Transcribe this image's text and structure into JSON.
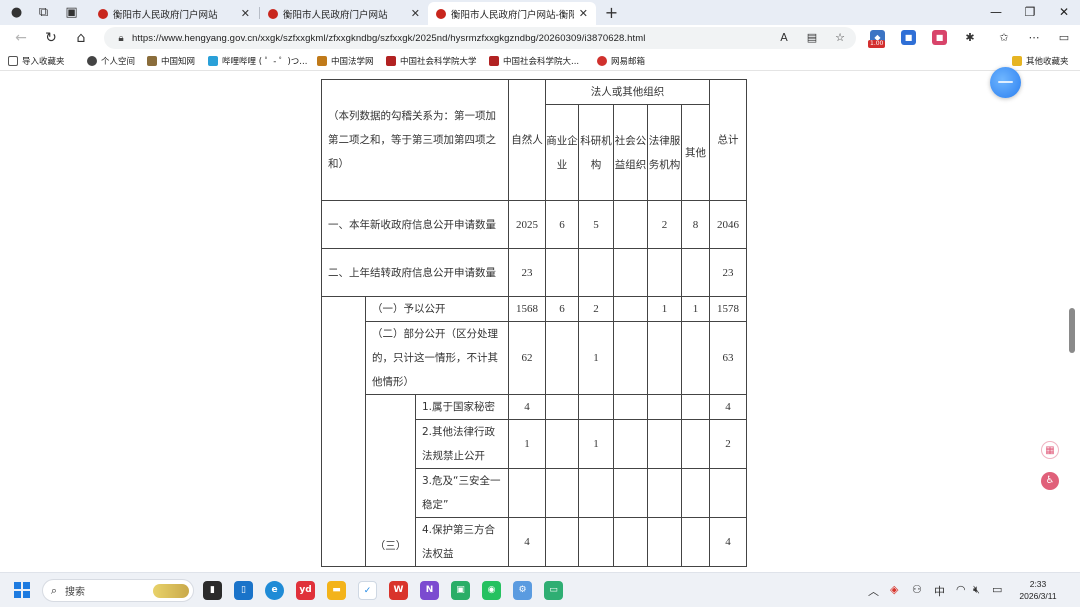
{
  "tabs": [
    {
      "title": "衡阳市人民政府门户网站",
      "active": false
    },
    {
      "title": "衡阳市人民政府门户网站",
      "active": false
    },
    {
      "title": "衡阳市人民政府门户网站-衡阳市...",
      "active": true
    }
  ],
  "tab_controls": {
    "new_tab": "+",
    "close": "✕"
  },
  "window": {
    "minimize": "—",
    "restore": "❐",
    "close": "✕"
  },
  "address": {
    "url": "https://www.hengyang.gov.cn/xxgk/szfxxgkml/zfxxgkndbg/szfxxgk/2025nd/hysrmzfxxgkgzndbg/20260309/i3870628.html"
  },
  "extension_badge": "1.00",
  "bookmarks": [
    {
      "label": "导入收藏夹",
      "color": "#555555"
    },
    {
      "label": "个人空间",
      "color": "#444444"
    },
    {
      "label": "中国知网",
      "color": "#8a6d3b"
    },
    {
      "label": "哔哩哔哩 ( ゜- ゜)つ...",
      "color": "#2aa0d8"
    },
    {
      "label": "中国法学网",
      "color": "#c07a1a"
    },
    {
      "label": "中国社会科学院大学",
      "color": "#b22222"
    },
    {
      "label": "中国社会科学院大...",
      "color": "#b22222"
    },
    {
      "label": "网易邮箱",
      "color": "#d0312d"
    },
    {
      "label": "其他收藏夹",
      "color": "#e6b422"
    }
  ],
  "table": {
    "header_note": "（本列数据的勾稽关系为：第一项加第二项之和，等于第三项加第四项之和）",
    "col_natural": "自然人",
    "col_group": "法人或其他组织",
    "col_business": "商业企业",
    "col_research": "科研机构",
    "col_social": "社会公益组织",
    "col_legal": "法律服务机构",
    "col_other": "其他",
    "col_total": "总计",
    "rows": [
      {
        "label": "一、本年新收政府信息公开申请数量",
        "values": [
          "2025",
          "6",
          "5",
          "",
          "2",
          "8",
          "2046"
        ]
      },
      {
        "label": "二、上年结转政府信息公开申请数量",
        "values": [
          "23",
          "",
          "",
          "",
          "",
          "",
          "23"
        ]
      },
      {
        "label": "（一）予以公开",
        "values": [
          "1568",
          "6",
          "2",
          "",
          "1",
          "1",
          "1578"
        ]
      },
      {
        "label": "（二）部分公开（区分处理的，只计这一情形，不计其他情形）",
        "values": [
          "62",
          "",
          "1",
          "",
          "",
          "",
          "63"
        ]
      },
      {
        "label": "1.属于国家秘密",
        "values": [
          "4",
          "",
          "",
          "",
          "",
          "",
          "4"
        ]
      },
      {
        "label": "2.其他法律行政法规禁止公开",
        "values": [
          "1",
          "",
          "1",
          "",
          "",
          "",
          "2"
        ]
      },
      {
        "label": "3.危及“三安全一稳定”",
        "values": [
          "",
          "",
          "",
          "",
          "",
          "",
          ""
        ]
      },
      {
        "label": "4.保护第三方合法权益",
        "values": [
          "4",
          "",
          "",
          "",
          "",
          "",
          "4"
        ]
      }
    ],
    "group_three": "（三）"
  },
  "taskbar": {
    "search_placeholder": "搜索",
    "ime": "中",
    "time": "2:33",
    "date": "2026/3/11"
  }
}
